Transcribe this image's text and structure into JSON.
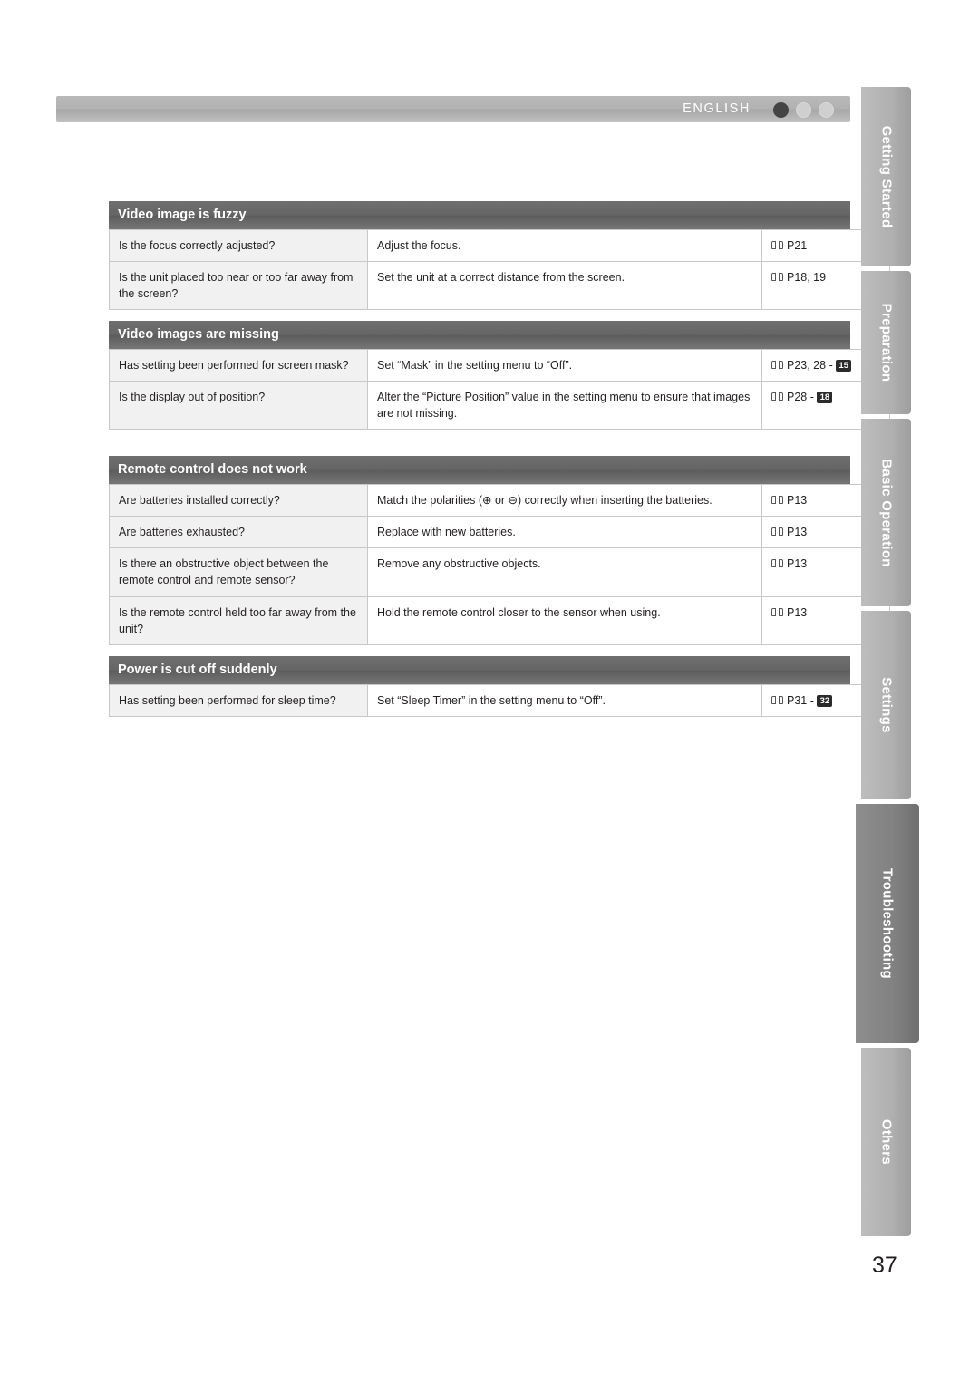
{
  "header": {
    "language": "ENGLISH",
    "dots": [
      "filled",
      "empty",
      "empty"
    ]
  },
  "tables": [
    {
      "title": "Video image is fuzzy",
      "rows": [
        {
          "question": "Is the focus correctly adjusted?",
          "action": "Adjust the focus.",
          "ref": "P21",
          "badge": ""
        },
        {
          "question": "Is the unit placed too near or too far away from the screen?",
          "action": "Set the unit at a correct distance from the screen.",
          "ref": "P18, 19",
          "badge": ""
        }
      ]
    },
    {
      "title": "Video images are missing",
      "rows": [
        {
          "question": "Has setting been performed for screen mask?",
          "action": "Set “Mask” in the setting menu to “Off”.",
          "ref": "P23, 28 - ",
          "badge": "15"
        },
        {
          "question": "Is the display out of position?",
          "action": "Alter the “Picture Position” value in the setting menu to ensure that images are not missing.",
          "ref": "P28 - ",
          "badge": "18"
        }
      ]
    },
    {
      "title": "Remote control does not work",
      "rows": [
        {
          "question": "Are batteries installed correctly?",
          "action": "Match the polarities (⊕ or ⊖) correctly when inserting the batteries.",
          "ref": "P13",
          "badge": ""
        },
        {
          "question": "Are batteries exhausted?",
          "action": "Replace with new batteries.",
          "ref": "P13",
          "badge": ""
        },
        {
          "question": "Is there an obstructive object between the remote control and remote sensor?",
          "action": "Remove any obstructive objects.",
          "ref": "P13",
          "badge": ""
        },
        {
          "question": "Is the remote control held too far away from the unit?",
          "action": "Hold the remote control closer to the sensor when using.",
          "ref": "P13",
          "badge": ""
        }
      ]
    },
    {
      "title": "Power is cut off suddenly",
      "rows": [
        {
          "question": "Has setting been performed for sleep time?",
          "action": "Set “Sleep Timer” in the setting menu to “Off”.",
          "ref": "P31 - ",
          "badge": "32"
        }
      ]
    }
  ],
  "side_tabs": [
    {
      "label": "Getting Started",
      "active": false
    },
    {
      "label": "Preparation",
      "active": false
    },
    {
      "label": "Basic Operation",
      "active": false
    },
    {
      "label": "Settings",
      "active": false
    },
    {
      "label": "Troubleshooting",
      "active": true
    },
    {
      "label": "Others",
      "active": false
    }
  ],
  "page_number": "37"
}
